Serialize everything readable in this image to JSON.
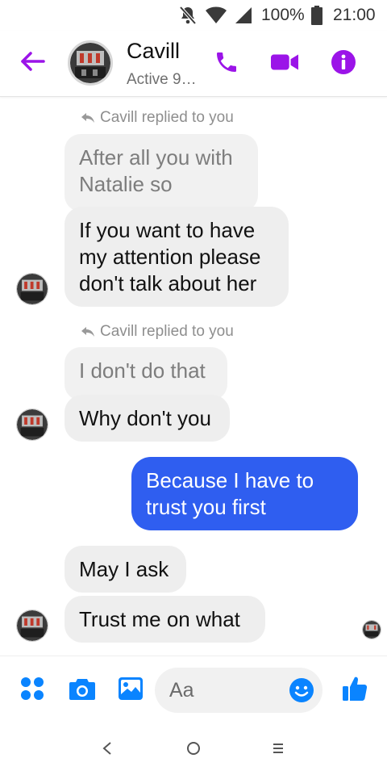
{
  "status_bar": {
    "battery": "100%",
    "time": "21:00"
  },
  "header": {
    "contact_name": "Cavill",
    "contact_status": "Active 9…"
  },
  "messages": [
    {
      "type": "reply_note",
      "text": "Cavill replied to you"
    },
    {
      "type": "quoted",
      "text": "After all you with Natalie so"
    },
    {
      "type": "incoming",
      "text": "If you want to have my attention please don't talk about her"
    },
    {
      "type": "reply_note",
      "text": "Cavill replied to you"
    },
    {
      "type": "quoted",
      "text": "I don't do that"
    },
    {
      "type": "incoming",
      "text": "Why don't you"
    },
    {
      "type": "outgoing",
      "text": "Because I have to trust you first"
    },
    {
      "type": "incoming",
      "text": "May I ask"
    },
    {
      "type": "incoming",
      "text": "Trust me on what"
    }
  ],
  "composer": {
    "placeholder": "Aa"
  },
  "colors": {
    "accent_purple": "#9b14e8",
    "outgoing_bubble": "#2f5ef0",
    "composer_blue": "#0a84ff"
  },
  "icons": [
    "mute-icon",
    "wifi-icon",
    "signal-icon",
    "battery-icon",
    "back-arrow-icon",
    "phone-icon",
    "video-icon",
    "info-icon",
    "reply-icon",
    "more-apps-icon",
    "camera-icon",
    "gallery-icon",
    "emoji-icon",
    "like-icon",
    "nav-back-icon",
    "nav-home-icon",
    "nav-recents-icon"
  ]
}
